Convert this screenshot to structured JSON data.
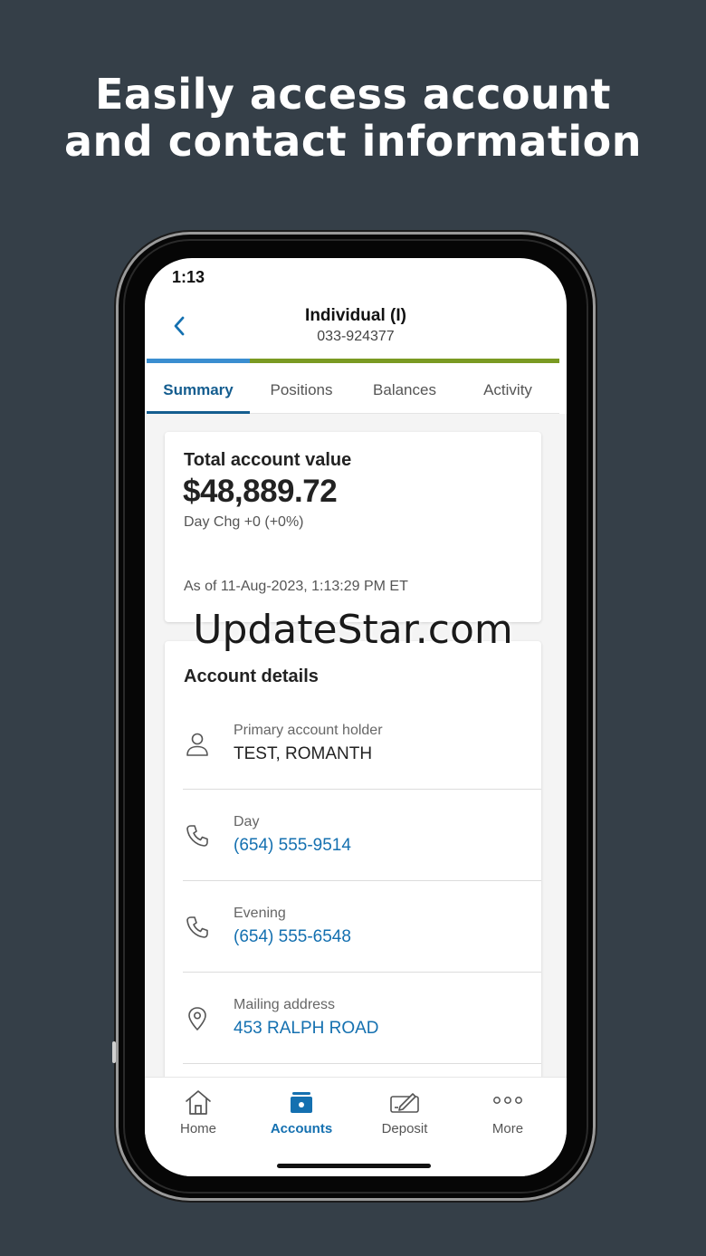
{
  "headline": {
    "line1": "Easily access account",
    "line2": "and contact information"
  },
  "status_bar": {
    "time": "1:13"
  },
  "header": {
    "account_name": "Individual (I)",
    "account_number": "033-924377",
    "progress": 0.25
  },
  "tabs": [
    {
      "label": "Summary",
      "active": true
    },
    {
      "label": "Positions",
      "active": false
    },
    {
      "label": "Balances",
      "active": false
    },
    {
      "label": "Activity",
      "active": false
    }
  ],
  "summary_card": {
    "title": "Total account value",
    "value": "$48,889.72",
    "day_change": "Day Chg +0 (+0%)",
    "as_of": "As of 11-Aug-2023, 1:13:29 PM ET"
  },
  "account_details": {
    "title": "Account details",
    "rows": [
      {
        "icon": "person-icon",
        "label": "Primary account holder",
        "value": "TEST, ROMANTH"
      },
      {
        "icon": "phone-icon",
        "label": "Day",
        "value": "(654) 555-9514"
      },
      {
        "icon": "phone-icon",
        "label": "Evening",
        "value": "(654) 555-6548"
      },
      {
        "icon": "location-pin-icon",
        "label": "Mailing address",
        "value": "453 RALPH ROAD"
      }
    ]
  },
  "bottom_nav": [
    {
      "icon": "home-icon",
      "label": "Home",
      "active": false
    },
    {
      "icon": "briefcase-icon",
      "label": "Accounts",
      "active": true
    },
    {
      "icon": "check-deposit-icon",
      "label": "Deposit",
      "active": false
    },
    {
      "icon": "more-dots-icon",
      "label": "More",
      "active": false
    }
  ],
  "watermark": "UpdateStar.com",
  "colors": {
    "background": "#353f48",
    "accent": "#1470b0",
    "progress_green": "#7a9a22",
    "progress_blue": "#3a8ed0"
  }
}
